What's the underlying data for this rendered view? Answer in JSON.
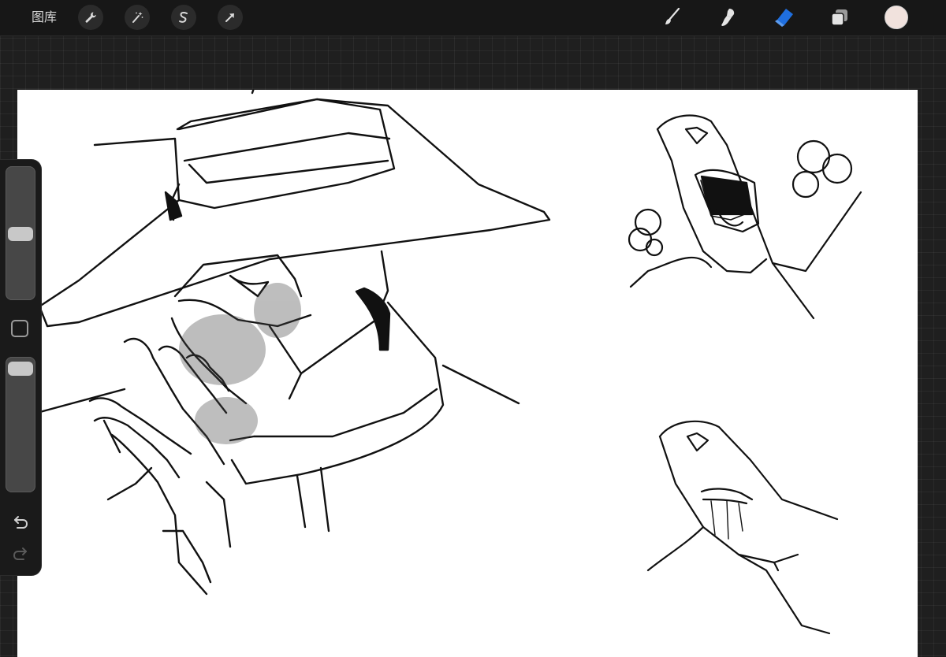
{
  "toolbar": {
    "gallery_label": "图库",
    "left_tools": [
      {
        "icon": "wrench-icon",
        "name": "actions"
      },
      {
        "icon": "magic-wand-icon",
        "name": "adjustments"
      },
      {
        "icon": "selection-s-icon",
        "name": "selection"
      },
      {
        "icon": "arrow-cursor-icon",
        "name": "transform"
      }
    ],
    "right_tools": [
      {
        "icon": "brush-icon",
        "name": "paint"
      },
      {
        "icon": "smudge-icon",
        "name": "smudge"
      },
      {
        "icon": "eraser-icon",
        "name": "erase",
        "active": true
      },
      {
        "icon": "layers-icon",
        "name": "layers"
      }
    ],
    "active_tool_color": "#1f6fe0",
    "current_color": "#f1e2dd"
  },
  "sidebar": {
    "brush_size_level": 0.28,
    "brush_opacity_level": 0.05,
    "modify_button_icon": "square-icon",
    "undo_icon": "undo-arrow-icon",
    "redo_icon": "redo-arrow-icon"
  },
  "canvas": {
    "background": "#ffffff",
    "artwork": "line-art-sketch"
  }
}
